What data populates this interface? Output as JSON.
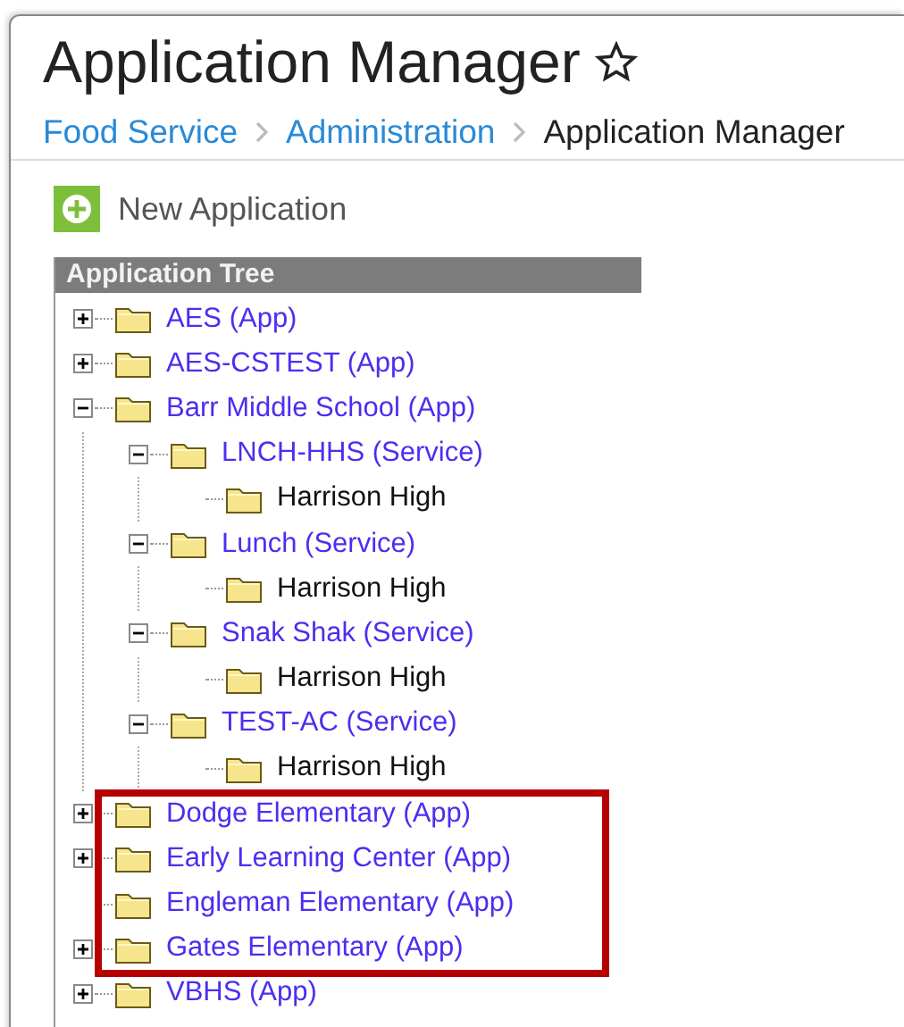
{
  "page": {
    "title": "Application Manager",
    "favorite": false
  },
  "breadcrumb": [
    {
      "label": "Food Service",
      "link": true
    },
    {
      "label": "Administration",
      "link": true
    },
    {
      "label": "Application Manager",
      "link": false
    }
  ],
  "toolbar": {
    "new_button": "New Application"
  },
  "tree": {
    "title": "Application Tree",
    "items": [
      {
        "label": "AES (App)",
        "kind": "app",
        "expanded": false
      },
      {
        "label": "AES-CSTEST (App)",
        "kind": "app",
        "expanded": false
      },
      {
        "label": "Barr Middle School (App)",
        "kind": "app",
        "expanded": true,
        "children": [
          {
            "label": "LNCH-HHS (Service)",
            "kind": "service",
            "expanded": true,
            "children": [
              {
                "label": "Harrison High",
                "kind": "school"
              }
            ]
          },
          {
            "label": "Lunch (Service)",
            "kind": "service",
            "expanded": true,
            "children": [
              {
                "label": "Harrison High",
                "kind": "school"
              }
            ]
          },
          {
            "label": "Snak Shak (Service)",
            "kind": "service",
            "expanded": true,
            "children": [
              {
                "label": "Harrison High",
                "kind": "school"
              }
            ]
          },
          {
            "label": "TEST-AC (Service)",
            "kind": "service",
            "expanded": true,
            "children": [
              {
                "label": "Harrison High",
                "kind": "school"
              }
            ]
          }
        ]
      },
      {
        "label": "Dodge Elementary (App)",
        "kind": "app",
        "expanded": false,
        "highlighted": true
      },
      {
        "label": "Early Learning Center (App)",
        "kind": "app",
        "expanded": false,
        "highlighted": true
      },
      {
        "label": "Engleman Elementary (App)",
        "kind": "app",
        "highlighted": true
      },
      {
        "label": "Gates Elementary (App)",
        "kind": "app",
        "expanded": false,
        "highlighted": true
      },
      {
        "label": "VBHS (App)",
        "kind": "app",
        "expanded": false
      }
    ]
  }
}
